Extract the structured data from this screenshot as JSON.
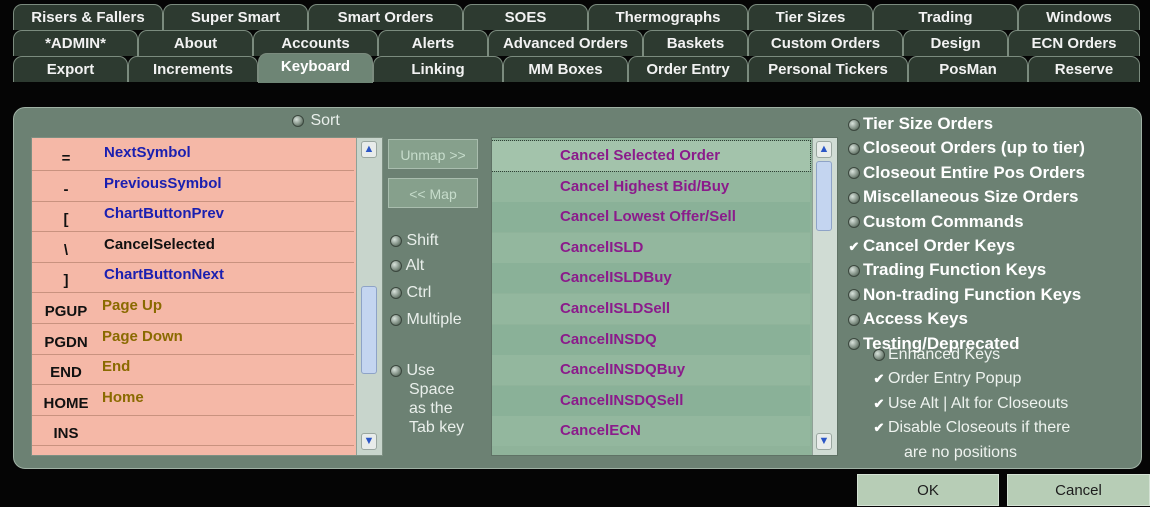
{
  "tabs": {
    "row1": [
      "Risers & Fallers",
      "Super Smart",
      "Smart Orders",
      "SOES",
      "Thermographs",
      "Tier Sizes",
      "Trading",
      "Windows"
    ],
    "row2": [
      "*ADMIN*",
      "About",
      "Accounts",
      "Alerts",
      "Advanced Orders",
      "Baskets",
      "Custom Orders",
      "Design",
      "ECN Orders"
    ],
    "row3": [
      "Export",
      "Increments",
      "Keyboard",
      "Linking",
      "MM Boxes",
      "Order Entry",
      "Personal Tickers",
      "PosMan",
      "Reserve"
    ],
    "active": "Keyboard"
  },
  "sort_label": "Sort",
  "key_list": [
    {
      "key": "=",
      "name": "NextSymbol"
    },
    {
      "key": "-",
      "name": "PreviousSymbol"
    },
    {
      "key": "[",
      "name": "ChartButtonPrev"
    },
    {
      "key": "\\",
      "name": "CancelSelected"
    },
    {
      "key": "]",
      "name": "ChartButtonNext"
    },
    {
      "key": "PGUP",
      "name": "Page Up"
    },
    {
      "key": "PGDN",
      "name": "Page Down"
    },
    {
      "key": "END",
      "name": "End"
    },
    {
      "key": "HOME",
      "name": "Home"
    },
    {
      "key": "INS",
      "name": ""
    }
  ],
  "unmap_label": "Unmap >>",
  "map_label": "<< Map",
  "modifiers": {
    "shift": "Shift",
    "alt": "Alt",
    "ctrl": "Ctrl",
    "multiple": "Multiple",
    "use_space_lines": [
      "Use",
      "Space",
      "as the",
      "Tab key"
    ]
  },
  "command_list": [
    "Cancel Selected Order",
    "Cancel Highest Bid/Buy",
    "Cancel Lowest Offer/Sell",
    "CancelISLD",
    "CancelISLDBuy",
    "CancelISLDSell",
    "CancelINSDQ",
    "CancelINSDQBuy",
    "CancelINSDQSell",
    "CancelECN"
  ],
  "categories": [
    {
      "label": "Tier Size Orders",
      "selected": false
    },
    {
      "label": "Closeout Orders (up to tier)",
      "selected": false
    },
    {
      "label": "Closeout Entire Pos Orders",
      "selected": false
    },
    {
      "label": "Miscellaneous Size Orders",
      "selected": false
    },
    {
      "label": "Custom Commands",
      "selected": false
    },
    {
      "label": "Cancel Order Keys",
      "selected": true
    },
    {
      "label": "Trading Function Keys",
      "selected": false
    },
    {
      "label": "Non-trading Function Keys",
      "selected": false
    },
    {
      "label": "Access Keys",
      "selected": false
    },
    {
      "label": "Testing/Deprecated",
      "selected": false
    }
  ],
  "sub_options": [
    {
      "label": "Enhanced Keys",
      "checked": false
    },
    {
      "label": "Order Entry Popup",
      "checked": true
    },
    {
      "label": "Use Alt | Alt for Closeouts",
      "checked": true
    },
    {
      "label": "Disable Closeouts if there",
      "checked": true
    }
  ],
  "sub_option_continuation": "are no positions",
  "ok_label": "OK",
  "cancel_label": "Cancel",
  "colors": {
    "key_row_bg": "#f5b8a7",
    "key_name_blue": "#1a1fb0",
    "key_name_olive": "#8a6a00",
    "command_text": "#8b1b8b",
    "command_bg": "#8fb39a"
  }
}
